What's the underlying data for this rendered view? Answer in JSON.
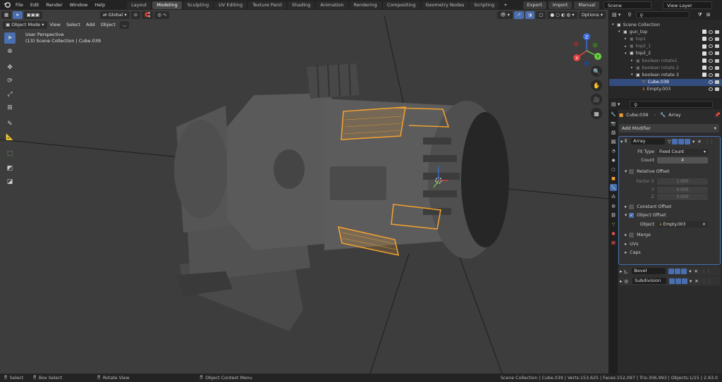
{
  "app": {
    "menus": [
      "File",
      "Edit",
      "Render",
      "Window",
      "Help"
    ],
    "workspaces": [
      "Layout",
      "Modeling",
      "Sculpting",
      "UV Editing",
      "Texture Paint",
      "Shading",
      "Animation",
      "Rendering",
      "Compositing",
      "Geometry Nodes",
      "Scripting"
    ],
    "active_workspace": "Modeling",
    "add_tab": "+",
    "export_label": "Export",
    "import_label": "Import",
    "manual_label": "Manual",
    "scene_name": "Scene",
    "view_layer": "View Layer"
  },
  "viewport": {
    "mode": "Object Mode",
    "menus": [
      "View",
      "Select",
      "Add",
      "Object"
    ],
    "orientation": "Global",
    "options_label": "Options",
    "overlay_line1": "User Perspective",
    "overlay_line2": "(13) Scene Collection | Cube.039",
    "gizmo_axes": {
      "x": "X",
      "y": "Y",
      "z": "Z"
    }
  },
  "outliner": {
    "rows": [
      {
        "name": "Scene Collection",
        "depth": 0,
        "type": "collection",
        "dim": false
      },
      {
        "name": "gun_top",
        "depth": 1,
        "type": "collection",
        "dim": false
      },
      {
        "name": "top1",
        "depth": 2,
        "type": "collection",
        "dim": true
      },
      {
        "name": "top2_1",
        "depth": 2,
        "type": "collection",
        "dim": true
      },
      {
        "name": "top2_2",
        "depth": 2,
        "type": "collection",
        "dim": false
      },
      {
        "name": "boolean rotate1",
        "depth": 3,
        "type": "collection",
        "dim": true
      },
      {
        "name": "boolean rotate 2",
        "depth": 3,
        "type": "collection",
        "dim": true
      },
      {
        "name": "boolean rotate 3",
        "depth": 3,
        "type": "collection",
        "dim": false
      },
      {
        "name": "Cube.039",
        "depth": 4,
        "type": "mesh",
        "dim": false,
        "selected": true
      },
      {
        "name": "Empty.003",
        "depth": 4,
        "type": "empty",
        "dim": false
      }
    ]
  },
  "properties": {
    "object_name": "Cube.039",
    "modifier_tab": "Array",
    "add_modifier_label": "Add Modifier",
    "array": {
      "name": "Array",
      "fit_type_label": "Fit Type",
      "fit_type_value": "Fixed Count",
      "count_label": "Count",
      "count_value": "4",
      "relative_offset_label": "Relative Offset",
      "factor_x_label": "Factor X",
      "factor_x": "1.000",
      "y_label": "Y",
      "y_value": "0.000",
      "z_label": "Z",
      "z_value": "0.000",
      "constant_offset_label": "Constant Offset",
      "object_offset_label": "Object Offset",
      "object_label": "Object",
      "object_value": "Empty.003",
      "merge_label": "Merge",
      "uvs_label": "UVs",
      "caps_label": "Caps"
    },
    "other_modifiers": [
      "Bevel",
      "Subdivision"
    ]
  },
  "statusbar": {
    "select": "Select",
    "box_select": "Box Select",
    "rotate_view": "Rotate View",
    "context_menu": "Object Context Menu",
    "stats": "Scene Collection | Cube.039 | Verts:153,625 | Faces:152,097 | Tris:306,993 | Objects:1/15 | 2.93.0"
  },
  "colors": {
    "accent": "#4a6fb1",
    "selection_orange": "#f0a030",
    "viewport_bg": "#3d3d3d",
    "mesh_gray": "#5a5a5a"
  }
}
